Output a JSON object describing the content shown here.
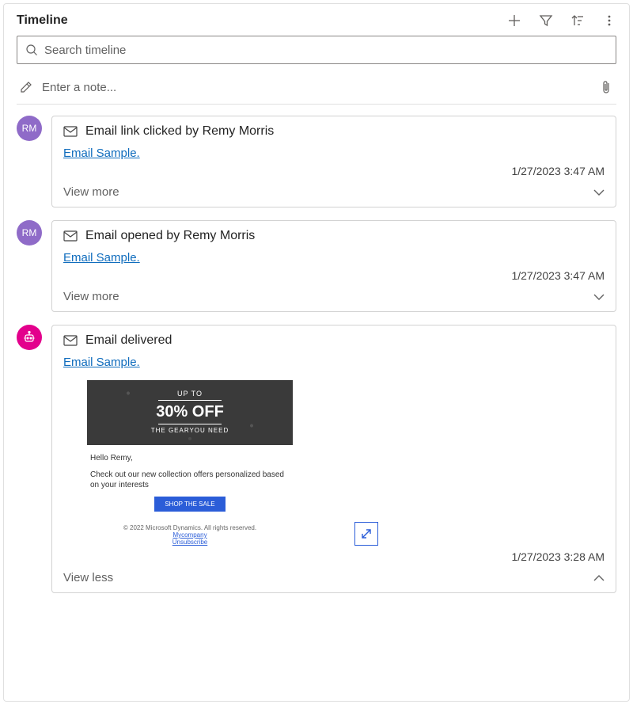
{
  "header": {
    "title": "Timeline"
  },
  "search": {
    "placeholder": "Search timeline"
  },
  "note": {
    "placeholder": "Enter a note..."
  },
  "entries": [
    {
      "avatar_initials": "RM",
      "avatar_type": "user",
      "title": "Email link clicked by Remy Morris",
      "link_text": "Email Sample.",
      "timestamp": "1/27/2023 3:47 AM",
      "toggle_label": "View more",
      "expanded": false
    },
    {
      "avatar_initials": "RM",
      "avatar_type": "user",
      "title": "Email opened by Remy Morris",
      "link_text": "Email Sample.",
      "timestamp": "1/27/2023 3:47 AM",
      "toggle_label": "View more",
      "expanded": false
    },
    {
      "avatar_initials": "",
      "avatar_type": "bot",
      "title": "Email delivered",
      "link_text": "Email Sample.",
      "timestamp": "1/27/2023 3:28 AM",
      "toggle_label": "View less",
      "expanded": true
    }
  ],
  "preview": {
    "upto": "UP TO",
    "percent": "30% OFF",
    "sub": "THE GEARYOU NEED",
    "hello": "Hello Remy,",
    "body": "Check out our new collection offers personalized based on your interests",
    "button": "SHOP THE SALE",
    "copyright": "© 2022 Microsoft Dynamics. All rights reserved.",
    "company_link": "Mycompany",
    "unsubscribe": "Unsubscribe"
  },
  "colors": {
    "accent_link": "#0f6cbd",
    "avatar_user": "#8f6bc8",
    "avatar_bot": "#e3008c"
  }
}
